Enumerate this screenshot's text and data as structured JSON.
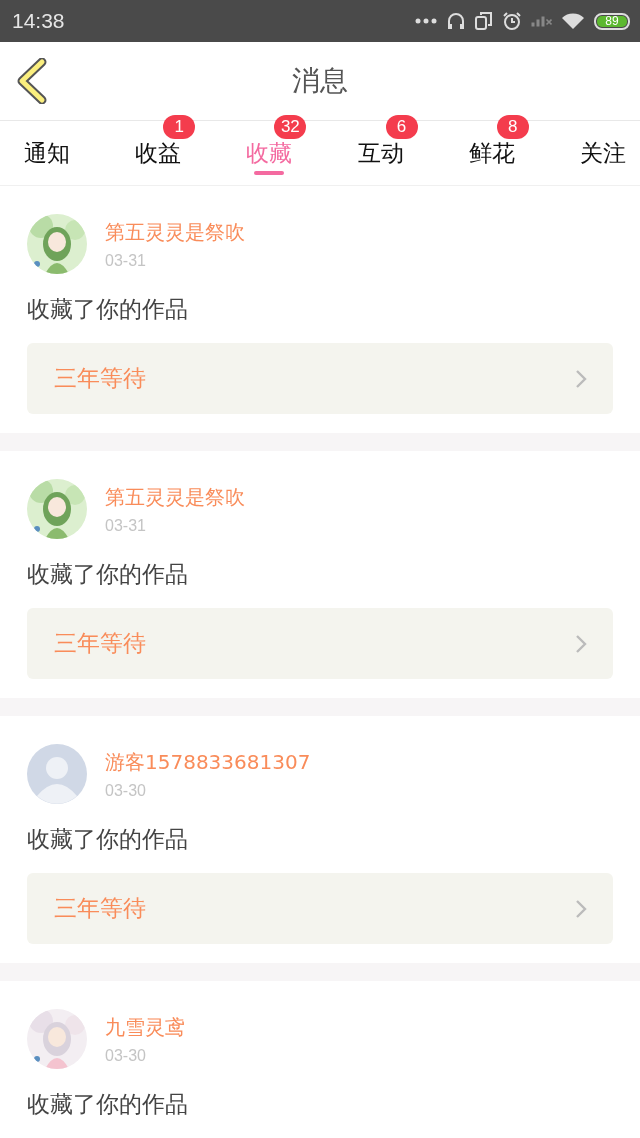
{
  "status_bar": {
    "time": "14:38",
    "battery": "89"
  },
  "header": {
    "title": "消息"
  },
  "tabs": [
    {
      "label": "通知",
      "selected": false
    },
    {
      "label": "收益",
      "selected": false,
      "badge": "1"
    },
    {
      "label": "收藏",
      "selected": true,
      "badge": "32"
    },
    {
      "label": "互动",
      "selected": false,
      "badge": "6"
    },
    {
      "label": "鲜花",
      "selected": false,
      "badge": "8"
    },
    {
      "label": "关注",
      "selected": false
    }
  ],
  "messages": [
    {
      "user": "第五灵灵是祭吹",
      "date": "03-31",
      "text": "收藏了你的作品",
      "work": "三年等待"
    },
    {
      "user": "第五灵灵是祭吹",
      "date": "03-31",
      "text": "收藏了你的作品",
      "work": "三年等待"
    },
    {
      "avatar": {
        "kind": "default"
      },
      "user": "游客1578833681307",
      "date": "03-30",
      "text": "收藏了你的作品",
      "work": "三年等待"
    },
    {
      "user": "九雪灵鸢",
      "date": "03-30",
      "text": "收藏了你的作品"
    }
  ]
}
